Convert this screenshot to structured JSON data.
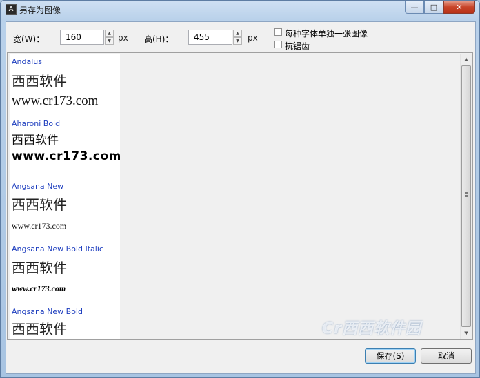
{
  "window": {
    "title": "另存为图像",
    "app_icon_glyph": "A"
  },
  "titlebar_buttons": {
    "minimize": "—",
    "maximize": "□",
    "close": "✕"
  },
  "toolbar": {
    "width_label": "宽(W)：",
    "width_value": "160",
    "width_unit": "px",
    "height_label": "高(H)：",
    "height_value": "455",
    "height_unit": "px",
    "per_font_label": "每种字体单独一张图像",
    "antialias_label": "抗锯齿",
    "per_font_checked": false,
    "antialias_checked": false
  },
  "preview": {
    "sample_cn": "西西软件",
    "sample_url": "www.cr173.com",
    "fonts": [
      {
        "name": "Andalus"
      },
      {
        "name": "Aharoni Bold"
      },
      {
        "name": "Angsana New"
      },
      {
        "name": "Angsana New Bold Italic"
      },
      {
        "name": "Angsana New Bold"
      }
    ]
  },
  "buttons": {
    "save": "保存(S)",
    "cancel": "取消"
  },
  "watermark": "Cr西西软件园",
  "colors": {
    "font_name": "#1f3fbf",
    "title_gradient_top": "#cfe0f3"
  }
}
